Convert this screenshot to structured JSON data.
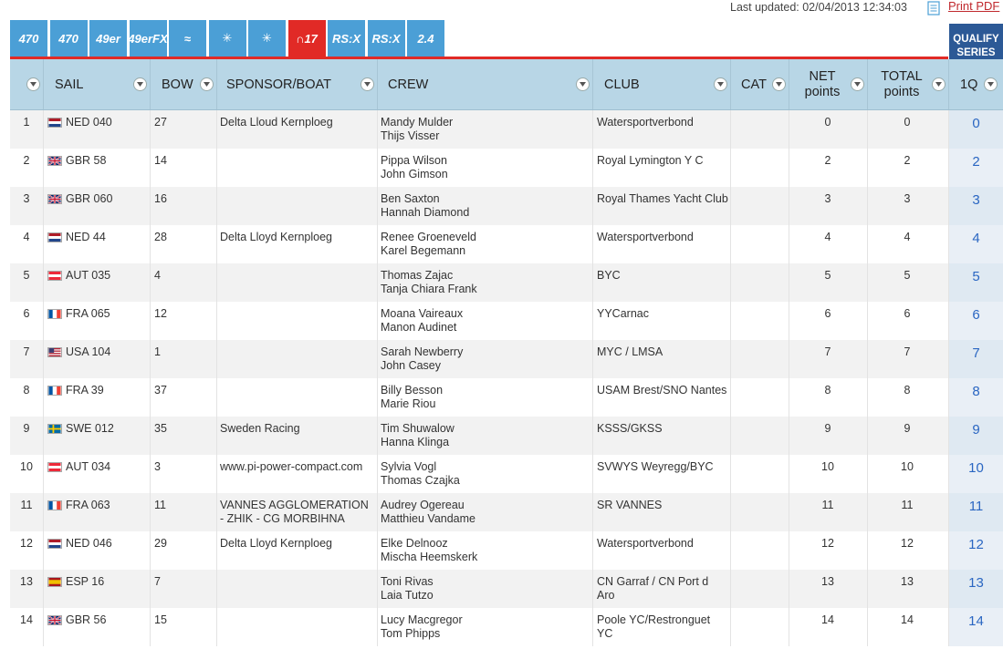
{
  "header": {
    "last_updated": "Last updated: 02/04/2013 12:34:03",
    "print_pdf": "Print PDF"
  },
  "classes": [
    {
      "label": "470",
      "icon": "470-class-icon"
    },
    {
      "label": "470",
      "icon": "470-women-class-icon"
    },
    {
      "label": "49er",
      "icon": "49er-class-icon"
    },
    {
      "label": "49erFX",
      "icon": "49erfx-class-icon"
    },
    {
      "label": "≈",
      "icon": "windsurf-wave-icon"
    },
    {
      "label": "✳",
      "icon": "star-class-icon"
    },
    {
      "label": "✳",
      "icon": "star-r-class-icon"
    },
    {
      "label": "∩17",
      "icon": "nacra17-class-icon"
    },
    {
      "label": "RS:X",
      "icon": "rsx-class-icon"
    },
    {
      "label": "RS:X",
      "icon": "rsx-women-class-icon"
    },
    {
      "label": "2.4",
      "icon": "2-4mR-class-icon"
    }
  ],
  "qualify_tab": "QUALIFY SERIES",
  "columns": {
    "sail": "SAIL",
    "bow": "BOW",
    "sponsor": "SPONSOR/BOAT",
    "crew": "CREW",
    "club": "CLUB",
    "cat": "CAT",
    "net": "NET points",
    "total": "TOTAL points",
    "race": "1Q"
  },
  "colors": {
    "accent_red": "#e12a26",
    "class_blue": "#4b9fd6",
    "header_bg": "#b8d6e6",
    "qualify_blue": "#2c5996",
    "link_blue": "#2a66c2"
  },
  "rows": [
    {
      "rank": "1",
      "flag": "NED",
      "sail": "NED 040",
      "bow": "27",
      "sponsor": "Delta Lloud Kernploeg",
      "crew1": "Mandy Mulder",
      "crew2": "Thijs Visser",
      "club": "Watersportverbond",
      "cat": "",
      "net": "0",
      "total": "0",
      "race": "0"
    },
    {
      "rank": "2",
      "flag": "GBR",
      "sail": "GBR 58",
      "bow": "14",
      "sponsor": "",
      "crew1": "Pippa Wilson",
      "crew2": "John Gimson",
      "club": "Royal Lymington Y C",
      "cat": "",
      "net": "2",
      "total": "2",
      "race": "2"
    },
    {
      "rank": "3",
      "flag": "GBR",
      "sail": "GBR 060",
      "bow": "16",
      "sponsor": "",
      "crew1": "Ben Saxton",
      "crew2": "Hannah Diamond",
      "club": "Royal Thames Yacht Club",
      "cat": "",
      "net": "3",
      "total": "3",
      "race": "3"
    },
    {
      "rank": "4",
      "flag": "NED",
      "sail": "NED 44",
      "bow": "28",
      "sponsor": "Delta Lloyd Kernploeg",
      "crew1": "Renee Groeneveld",
      "crew2": "Karel Begemann",
      "club": "Watersportverbond",
      "cat": "",
      "net": "4",
      "total": "4",
      "race": "4"
    },
    {
      "rank": "5",
      "flag": "AUT",
      "sail": "AUT 035",
      "bow": "4",
      "sponsor": "",
      "crew1": "Thomas Zajac",
      "crew2": "Tanja Chiara Frank",
      "club": "BYC",
      "cat": "",
      "net": "5",
      "total": "5",
      "race": "5"
    },
    {
      "rank": "6",
      "flag": "FRA",
      "sail": "FRA 065",
      "bow": "12",
      "sponsor": "",
      "crew1": "Moana Vaireaux",
      "crew2": "Manon Audinet",
      "club": "YYCarnac",
      "cat": "",
      "net": "6",
      "total": "6",
      "race": "6"
    },
    {
      "rank": "7",
      "flag": "USA",
      "sail": "USA 104",
      "bow": "1",
      "sponsor": "",
      "crew1": "Sarah Newberry",
      "crew2": "John Casey",
      "club": "MYC / LMSA",
      "cat": "",
      "net": "7",
      "total": "7",
      "race": "7"
    },
    {
      "rank": "8",
      "flag": "FRA",
      "sail": "FRA 39",
      "bow": "37",
      "sponsor": "",
      "crew1": "Billy Besson",
      "crew2": "Marie Riou",
      "club": "USAM Brest/SNO Nantes",
      "cat": "",
      "net": "8",
      "total": "8",
      "race": "8"
    },
    {
      "rank": "9",
      "flag": "SWE",
      "sail": "SWE 012",
      "bow": "35",
      "sponsor": "Sweden Racing",
      "crew1": "Tim Shuwalow",
      "crew2": "Hanna Klinga",
      "club": "KSSS/GKSS",
      "cat": "",
      "net": "9",
      "total": "9",
      "race": "9"
    },
    {
      "rank": "10",
      "flag": "AUT",
      "sail": "AUT 034",
      "bow": "3",
      "sponsor": "www.pi-power-compact.com",
      "crew1": "Sylvia Vogl",
      "crew2": "Thomas Czajka",
      "club": "SVWYS Weyregg/BYC",
      "cat": "",
      "net": "10",
      "total": "10",
      "race": "10"
    },
    {
      "rank": "11",
      "flag": "FRA",
      "sail": "FRA 063",
      "bow": "11",
      "sponsor": "VANNES AGGLOMERATION - ZHIK - CG MORBIHNA",
      "crew1": "Audrey Ogereau",
      "crew2": "Matthieu Vandame",
      "club": "SR VANNES",
      "cat": "",
      "net": "11",
      "total": "11",
      "race": "11"
    },
    {
      "rank": "12",
      "flag": "NED",
      "sail": "NED 046",
      "bow": "29",
      "sponsor": "Delta Lloyd Kernploeg",
      "crew1": "Elke Delnooz",
      "crew2": "Mischa Heemskerk",
      "club": "Watersportverbond",
      "cat": "",
      "net": "12",
      "total": "12",
      "race": "12"
    },
    {
      "rank": "13",
      "flag": "ESP",
      "sail": "ESP 16",
      "bow": "7",
      "sponsor": "",
      "crew1": "Toni Rivas",
      "crew2": "Laia Tutzo",
      "club": "CN Garraf / CN Port d Aro",
      "cat": "",
      "net": "13",
      "total": "13",
      "race": "13"
    },
    {
      "rank": "14",
      "flag": "GBR",
      "sail": "GBR 56",
      "bow": "15",
      "sponsor": "",
      "crew1": "Lucy Macgregor",
      "crew2": "Tom Phipps",
      "club": "Poole YC/Restronguet YC",
      "cat": "",
      "net": "14",
      "total": "14",
      "race": "14"
    }
  ]
}
